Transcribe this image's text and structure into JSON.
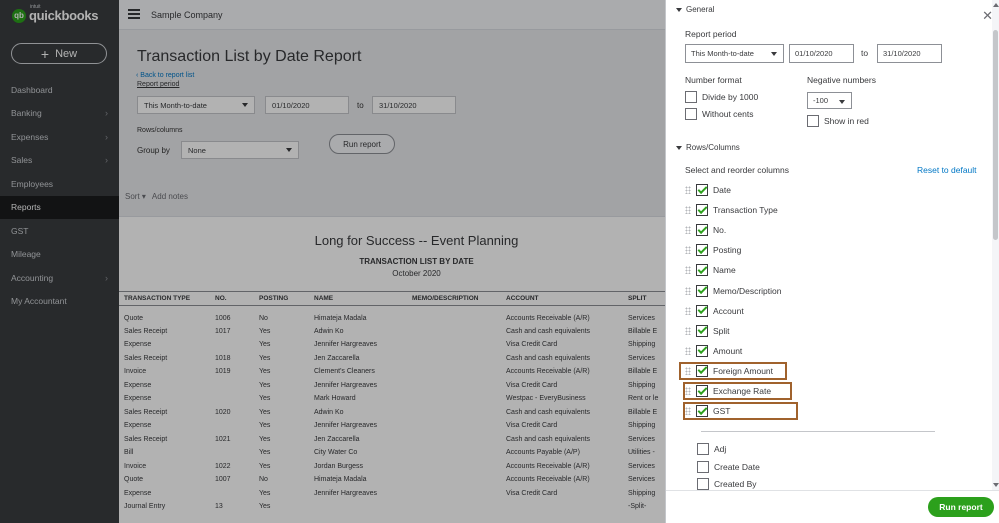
{
  "nav": {
    "brand": "quickbooks",
    "brand_small": "intuit",
    "new_label": "New",
    "items": [
      {
        "label": "Dashboard",
        "chevron": false
      },
      {
        "label": "Banking",
        "chevron": true
      },
      {
        "label": "Expenses",
        "chevron": true
      },
      {
        "label": "Sales",
        "chevron": true
      },
      {
        "label": "Employees",
        "chevron": false
      },
      {
        "label": "Reports",
        "chevron": false,
        "active": true
      },
      {
        "label": "GST",
        "chevron": false
      },
      {
        "label": "Mileage",
        "chevron": false
      },
      {
        "label": "Accounting",
        "chevron": true
      },
      {
        "label": "My Accountant",
        "chevron": false
      }
    ]
  },
  "topbar": {
    "company": "Sample Company"
  },
  "report": {
    "title": "Transaction List by Date Report",
    "back_link": "Back to report list",
    "report_period_label": "Report period",
    "period_value": "This Month-to-date",
    "from_date": "01/10/2020",
    "to_label": "to",
    "to_date": "31/10/2020",
    "rows_columns_label": "Rows/columns",
    "group_by_label": "Group by",
    "group_by_value": "None",
    "run_report_label": "Run report",
    "sort_label": "Sort",
    "add_notes_label": "Add notes",
    "company_name": "Long for Success -- Event Planning",
    "report_heading": "TRANSACTION LIST BY DATE",
    "report_date": "October 2020",
    "columns": [
      "TRANSACTION TYPE",
      "NO.",
      "POSTING",
      "NAME",
      "MEMO/DESCRIPTION",
      "ACCOUNT",
      "SPLIT"
    ],
    "rows": [
      [
        "Quote",
        "1006",
        "No",
        "Himateja Madala",
        "",
        "Accounts Receivable (A/R)",
        "Services"
      ],
      [
        "Sales Receipt",
        "1017",
        "Yes",
        "Adwin Ko",
        "",
        "Cash and cash equivalents",
        "Billable E"
      ],
      [
        "Expense",
        "",
        "Yes",
        "Jennifer Hargreaves",
        "",
        "Visa Credit Card",
        "Shipping"
      ],
      [
        "Sales Receipt",
        "1018",
        "Yes",
        "Jen Zaccarella",
        "",
        "Cash and cash equivalents",
        "Services"
      ],
      [
        "Invoice",
        "1019",
        "Yes",
        "Clement's Cleaners",
        "",
        "Accounts Receivable (A/R)",
        "Billable E"
      ],
      [
        "Expense",
        "",
        "Yes",
        "Jennifer Hargreaves",
        "",
        "Visa Credit Card",
        "Shipping"
      ],
      [
        "Expense",
        "",
        "Yes",
        "Mark Howard",
        "",
        "Westpac - EveryBusiness",
        "Rent or le"
      ],
      [
        "Sales Receipt",
        "1020",
        "Yes",
        "Adwin Ko",
        "",
        "Cash and cash equivalents",
        "Billable E"
      ],
      [
        "Expense",
        "",
        "Yes",
        "Jennifer Hargreaves",
        "",
        "Visa Credit Card",
        "Shipping"
      ],
      [
        "Sales Receipt",
        "1021",
        "Yes",
        "Jen Zaccarella",
        "",
        "Cash and cash equivalents",
        "Services"
      ],
      [
        "Bill",
        "",
        "Yes",
        "City Water Co",
        "",
        "Accounts Payable (A/P)",
        "Utilities -"
      ],
      [
        "Invoice",
        "1022",
        "Yes",
        "Jordan Burgess",
        "",
        "Accounts Receivable (A/R)",
        "Services"
      ],
      [
        "Quote",
        "1007",
        "No",
        "Himateja Madala",
        "",
        "Accounts Receivable (A/R)",
        "Services"
      ],
      [
        "Expense",
        "",
        "Yes",
        "Jennifer Hargreaves",
        "",
        "Visa Credit Card",
        "Shipping"
      ],
      [
        "Journal Entry",
        "13",
        "Yes",
        "",
        "",
        "",
        "-Split-"
      ]
    ]
  },
  "panel": {
    "general_label": "General",
    "report_period_label": "Report period",
    "period_value": "This Month-to-date",
    "from_date": "01/10/2020",
    "to_label": "to",
    "to_date": "31/10/2020",
    "number_format_label": "Number format",
    "divide_label": "Divide by 1000",
    "cents_label": "Without cents",
    "negative_label": "Negative numbers",
    "negative_value": "-100",
    "show_red_label": "Show in red",
    "rows_columns_label": "Rows/Columns",
    "select_label": "Select and reorder columns",
    "reset_label": "Reset to default",
    "checked_columns": [
      "Date",
      "Transaction Type",
      "No.",
      "Posting",
      "Name",
      "Memo/Description",
      "Account",
      "Split",
      "Amount",
      "Foreign Amount",
      "Exchange Rate",
      "GST"
    ],
    "unchecked_columns": [
      "Adj",
      "Create Date",
      "Created By"
    ],
    "run_report_label": "Run report"
  },
  "colors": {
    "brand_green": "#2ca01c",
    "nav_bg": "#3a3d40",
    "highlight": "#a0622d",
    "link": "#0077c5"
  }
}
